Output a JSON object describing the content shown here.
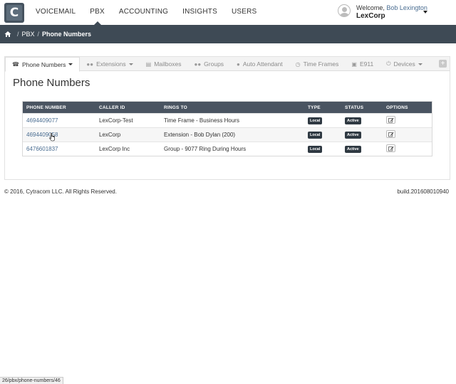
{
  "nav": {
    "logo_letter": "C",
    "items": [
      {
        "label": "VOICEMAIL"
      },
      {
        "label": "PBX"
      },
      {
        "label": "ACCOUNTING"
      },
      {
        "label": "INSIGHTS"
      },
      {
        "label": "USERS"
      }
    ],
    "active": "PBX",
    "welcome_prefix": "Welcome,",
    "user_name": "Bob Lexington",
    "company": "LexCorp"
  },
  "breadcrumb": {
    "items": [
      "PBX",
      "Phone Numbers"
    ],
    "separator": "/"
  },
  "tabs": [
    {
      "label": "Phone Numbers",
      "icon": "phone-icon",
      "active": true,
      "dropdown": true
    },
    {
      "label": "Extensions",
      "icon": "users-icon",
      "active": false,
      "dropdown": true
    },
    {
      "label": "Mailboxes",
      "icon": "inbox-icon",
      "active": false,
      "dropdown": false
    },
    {
      "label": "Groups",
      "icon": "group-icon",
      "active": false,
      "dropdown": false
    },
    {
      "label": "Auto Attendant",
      "icon": "user-icon",
      "active": false,
      "dropdown": false
    },
    {
      "label": "Time Frames",
      "icon": "clock-icon",
      "active": false,
      "dropdown": false
    },
    {
      "label": "E911",
      "icon": "emergency-icon",
      "active": false,
      "dropdown": false
    },
    {
      "label": "Devices",
      "icon": "power-icon",
      "active": false,
      "dropdown": true
    }
  ],
  "page_title": "Phone Numbers",
  "table": {
    "headers": [
      "PHONE NUMBER",
      "CALLER ID",
      "RINGS TO",
      "TYPE",
      "STATUS",
      "OPTIONS"
    ],
    "rows": [
      {
        "phone": "4694409077",
        "caller_id": "LexCorp-Test",
        "rings_to": "Time Frame - Business Hours",
        "type": "Local",
        "status": "Active"
      },
      {
        "phone": "4694409058",
        "caller_id": "LexCorp",
        "rings_to": "Extension - Bob Dylan (200)",
        "type": "Local",
        "status": "Active"
      },
      {
        "phone": "6476601837",
        "caller_id": "LexCorp Inc",
        "rings_to": "Group - 9077 Ring During Hours",
        "type": "Local",
        "status": "Active"
      }
    ]
  },
  "footer": {
    "copyright": "© 2016, Cytracom LLC. All Rights Reserved.",
    "build": "build.201608010940"
  },
  "status_url": "26/pbx/phone-numbers/46",
  "colors": {
    "navbar_dark": "#3e4a55",
    "table_header": "#4a5461",
    "link": "#4a6d91",
    "badge": "#2f3942"
  }
}
